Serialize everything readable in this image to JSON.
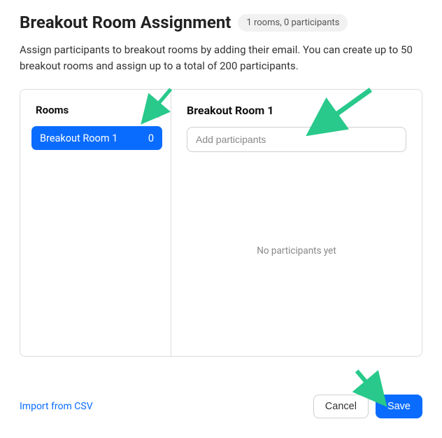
{
  "header": {
    "title": "Breakout Room Assignment",
    "subcount": "1 rooms, 0 participants",
    "description": "Assign participants to breakout rooms by adding their email. You can create up to 50 breakout rooms and assign up to a total of 200 participants."
  },
  "rooms": {
    "title": "Rooms",
    "add_label": "+",
    "items": [
      {
        "name": "Breakout Room 1",
        "count": "0"
      }
    ]
  },
  "detail": {
    "title": "Breakout Room 1",
    "input_placeholder": "Add participants",
    "empty_text": "No participants yet"
  },
  "footer": {
    "import_label": "Import from CSV",
    "cancel_label": "Cancel",
    "save_label": "Save"
  }
}
